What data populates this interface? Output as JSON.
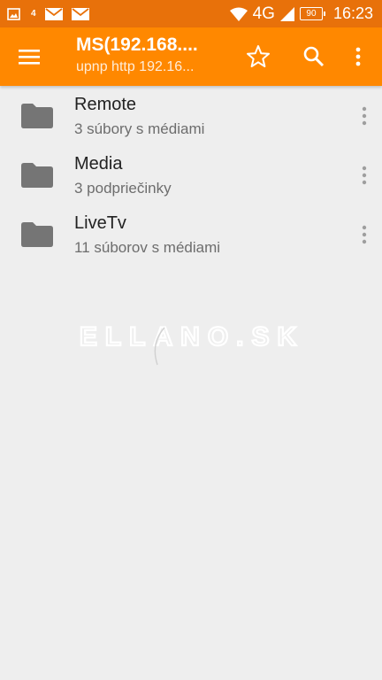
{
  "status_bar": {
    "small_label": "4",
    "network": "4G",
    "battery": "90",
    "time": "16:23"
  },
  "app_bar": {
    "title": "MS(192.168....",
    "subtitle": "upnp http 192.16..."
  },
  "items": [
    {
      "title": "Remote",
      "subtitle": "3 súbory s médiami"
    },
    {
      "title": "Media",
      "subtitle": "3 podpriečinky"
    },
    {
      "title": "LiveTv",
      "subtitle": "11 súborov s médiami"
    }
  ],
  "watermark": "ELLANO.SK",
  "colors": {
    "accent": "#ff8800",
    "status_bar": "#e8710a",
    "folder": "#757575",
    "background": "#eeeeee"
  }
}
